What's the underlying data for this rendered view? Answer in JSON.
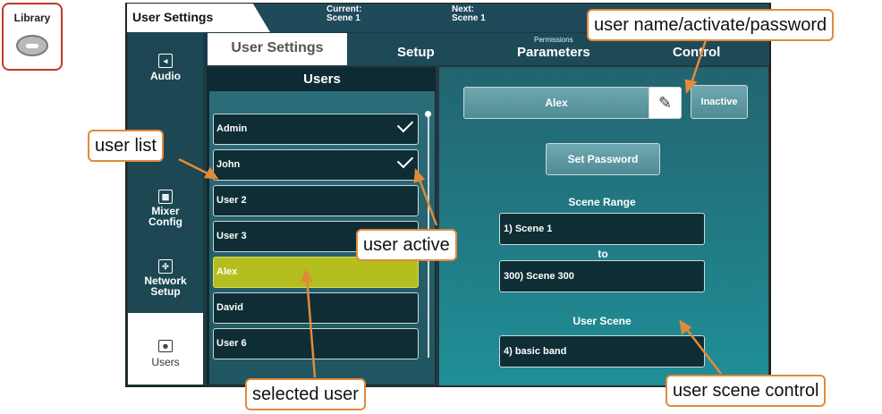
{
  "library": {
    "label": "Library"
  },
  "header": {
    "title": "User Settings",
    "current_label": "Current:",
    "current_scene": "Scene 1",
    "next_label": "Next:",
    "next_scene": "Scene 1"
  },
  "nav": {
    "audio": "Audio",
    "mixer_config": "Mixer Config",
    "network_setup": "Network Setup",
    "users": "Users"
  },
  "tabs": {
    "user_settings": "User Settings",
    "setup": "Setup",
    "permissions_caption": "Permissions",
    "parameters": "Parameters",
    "control": "Control"
  },
  "users_panel": {
    "title": "Users",
    "users": [
      {
        "name": "Admin",
        "active": true
      },
      {
        "name": "John",
        "active": true
      },
      {
        "name": "User 2",
        "active": false
      },
      {
        "name": "User 3",
        "active": false
      },
      {
        "name": "Alex",
        "active": false,
        "selected": true
      },
      {
        "name": "David",
        "active": false
      },
      {
        "name": "User 6",
        "active": false
      }
    ]
  },
  "user_details": {
    "name": "Alex",
    "status_button": "Inactive",
    "set_password": "Set Password",
    "scene_range_label": "Scene Range",
    "range_from": "1) Scene 1",
    "to_label": "to",
    "range_to": "300) Scene 300",
    "user_scene_label": "User Scene",
    "user_scene": "4) basic band"
  },
  "callouts": {
    "name_activate_password": "user name/activate/password",
    "user_list": "user list",
    "user_active": "user active",
    "selected_user": "selected user",
    "user_scene_control": "user scene control"
  },
  "colors": {
    "callout_border": "#e28a3a",
    "selected_row": "#b4be1e",
    "library_border": "#c0392b"
  }
}
